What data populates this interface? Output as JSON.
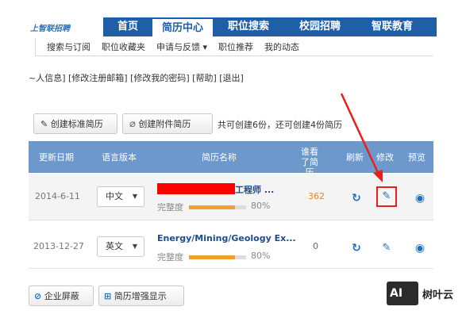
{
  "logo": "上智联招聘",
  "nav": {
    "tabs": [
      "首页",
      "简历中心",
      "职位搜索",
      "校园招聘",
      "智联教育"
    ],
    "active": 1
  },
  "subnav": {
    "items": [
      "搜索与订阅",
      "职位收藏夹",
      "申请与反馈 ▾",
      "职位推荐",
      "我的动态"
    ]
  },
  "account_links": "~人信息] [修改注册邮箱] [修改我的密码] [帮助] [退出]",
  "toolbar": {
    "create_standard": "创建标准简历",
    "create_attachment": "创建附件简历",
    "summary": "共可创建6份，还可创建4份简历"
  },
  "table": {
    "headers": {
      "updated": "更新日期",
      "language": "语言版本",
      "name": "简历名称",
      "viewed": "谁看了简历",
      "refresh": "刷新",
      "edit": "修改",
      "preview": "预览"
    },
    "rows": [
      {
        "date": "2014-6-11",
        "lang": "中文",
        "name": "工程师 ...",
        "completeness_label": "完整度",
        "completeness": 80,
        "completeness_text": "80%",
        "views": "362"
      },
      {
        "date": "2013-12-27",
        "lang": "英文",
        "name": "Energy/Mining/Geology Ex...",
        "completeness_label": "完整度",
        "completeness": 80,
        "completeness_text": "80%",
        "views": "0"
      }
    ]
  },
  "footer": {
    "block_companies": "企业屏蔽",
    "enhanced_display": "简历增强显示"
  },
  "watermark": {
    "icon_text": "AI",
    "name": "树叶云"
  },
  "colors": {
    "nav_blue": "#1e5fa8",
    "header_blue": "#6d98cc",
    "annotation_red": "#e8201c",
    "views_orange": "#e8862c"
  }
}
